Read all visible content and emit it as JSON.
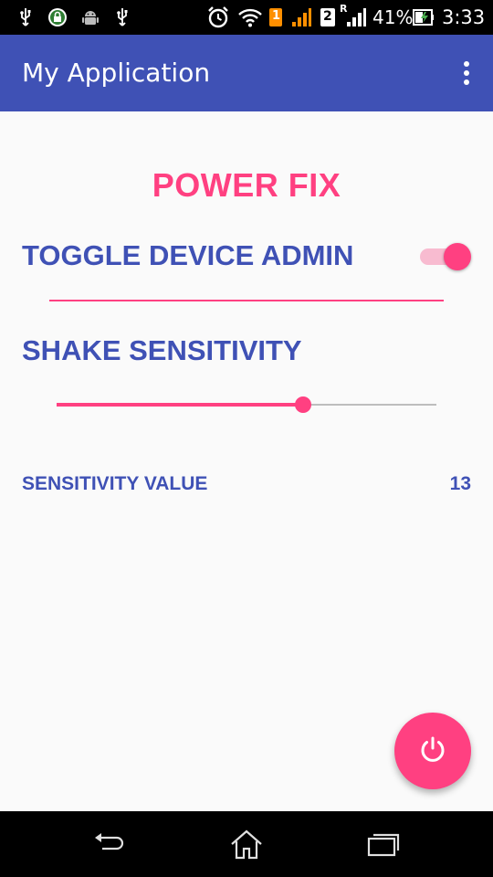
{
  "status_bar": {
    "battery_percent": "41%",
    "time": "3:33",
    "sim1": "1",
    "sim2": "2",
    "roaming": "R",
    "icons": [
      "usb-icon",
      "lock-icon",
      "android-icon",
      "usb-icon",
      "alarm-icon",
      "wifi-icon",
      "signal-icon",
      "signal-icon",
      "battery-icon"
    ]
  },
  "app_bar": {
    "title": "My Application",
    "menu_icon": "more-vert-icon"
  },
  "main": {
    "title": "POWER FIX",
    "toggle_label": "TOGGLE DEVICE ADMIN",
    "toggle_on": true,
    "shake_label": "SHAKE SENSITIVITY",
    "slider_fraction": 0.65,
    "sensitivity_label": "SENSITIVITY VALUE",
    "sensitivity_value": "13",
    "fab_icon": "power-icon"
  },
  "nav_bar": {
    "icons": [
      "back-icon",
      "home-icon",
      "recents-icon"
    ]
  },
  "colors": {
    "primary": "#3f51b5",
    "accent": "#ff4081",
    "background": "#fafafa"
  }
}
